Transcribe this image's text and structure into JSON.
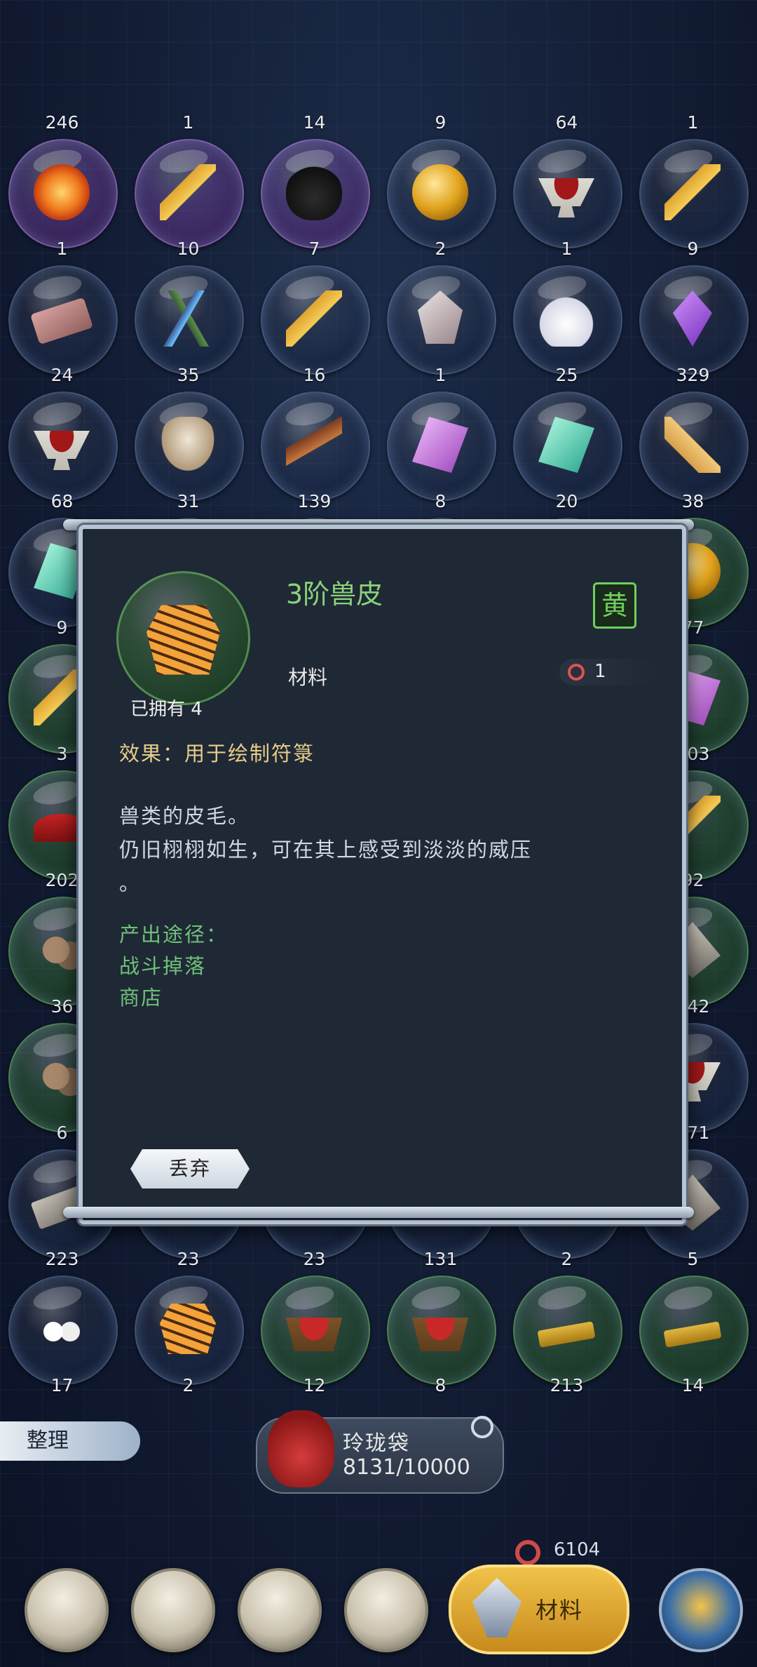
{
  "inventory": {
    "rows": [
      {
        "counts": [
          "246",
          "1",
          "14",
          "9",
          "64",
          "1"
        ],
        "items": [
          [
            "fire-orb",
            "fire",
            "purple"
          ],
          [
            "golden-feather",
            "feather",
            "purple"
          ],
          [
            "beetle",
            "beetle",
            "purple"
          ],
          [
            "gold-orb",
            "goldorb",
            ""
          ],
          [
            "blood-bowl",
            "bowl",
            ""
          ],
          [
            "golden-feather",
            "feather",
            ""
          ]
        ]
      },
      {
        "counts": [
          "1",
          "10",
          "7",
          "2",
          "1",
          "9"
        ],
        "items": [
          [
            "pink-brick",
            "brick",
            ""
          ],
          [
            "lightning-branch",
            "branch",
            ""
          ],
          [
            "golden-feather",
            "feather",
            ""
          ],
          [
            "quartz",
            "crystal",
            ""
          ],
          [
            "white-lotus",
            "lotus",
            ""
          ],
          [
            "purple-gem",
            "gem",
            ""
          ]
        ]
      },
      {
        "counts": [
          "24",
          "35",
          "16",
          "1",
          "25",
          "329"
        ],
        "items": [
          [
            "blood-bowl",
            "bowl",
            ""
          ],
          [
            "lingzhi",
            "fungus",
            ""
          ],
          [
            "wood-bundle",
            "wood",
            ""
          ],
          [
            "pink-gem",
            "pinkgem",
            ""
          ],
          [
            "jade",
            "jade",
            ""
          ],
          [
            "ginseng",
            "root",
            ""
          ]
        ]
      },
      {
        "counts": [
          "68",
          "31",
          "139",
          "8",
          "20",
          "38"
        ],
        "items": [
          [
            "blue-leaf",
            "jade",
            ""
          ],
          [
            "x",
            "",
            ""
          ],
          [
            "x",
            "",
            ""
          ],
          [
            "x",
            "",
            ""
          ],
          [
            "x",
            "",
            ""
          ],
          [
            "gold-orb",
            "goldorb",
            "green"
          ]
        ]
      },
      {
        "counts": [
          "9",
          "",
          "",
          "",
          "",
          "77"
        ],
        "items": [
          [
            "golden-feather",
            "feather",
            "green"
          ],
          [
            "x",
            "",
            ""
          ],
          [
            "x",
            "",
            ""
          ],
          [
            "x",
            "",
            ""
          ],
          [
            "x",
            "",
            ""
          ],
          [
            "pink-gem",
            "pinkgem",
            "green"
          ]
        ]
      },
      {
        "counts": [
          "3",
          "",
          "",
          "",
          "",
          "203"
        ],
        "items": [
          [
            "red-pile",
            "redpile",
            "green"
          ],
          [
            "x",
            "",
            ""
          ],
          [
            "x",
            "",
            ""
          ],
          [
            "x",
            "",
            ""
          ],
          [
            "x",
            "",
            ""
          ],
          [
            "golden-feather",
            "feather",
            "green"
          ]
        ]
      },
      {
        "counts": [
          "202",
          "",
          "",
          "",
          "",
          "92"
        ],
        "items": [
          [
            "pebbles",
            "pebbles",
            "green"
          ],
          [
            "x",
            "",
            ""
          ],
          [
            "x",
            "",
            ""
          ],
          [
            "x",
            "",
            ""
          ],
          [
            "x",
            "",
            ""
          ],
          [
            "shell",
            "shell",
            "green"
          ]
        ]
      },
      {
        "counts": [
          "36",
          "",
          "",
          "",
          "",
          "142"
        ],
        "items": [
          [
            "pebbles",
            "pebbles",
            "green"
          ],
          [
            "x",
            "",
            ""
          ],
          [
            "x",
            "",
            ""
          ],
          [
            "x",
            "",
            ""
          ],
          [
            "x",
            "",
            ""
          ],
          [
            "blood-bowl",
            "bowl",
            ""
          ]
        ]
      },
      {
        "counts": [
          "6",
          "",
          "",
          "",
          "",
          "171"
        ],
        "items": [
          [
            "silver-bar",
            "silverbar",
            ""
          ],
          [
            "x",
            "",
            ""
          ],
          [
            "x",
            "",
            ""
          ],
          [
            "x",
            "",
            ""
          ],
          [
            "x",
            "",
            ""
          ],
          [
            "shell",
            "shell",
            ""
          ]
        ]
      },
      {
        "counts": [
          "223",
          "23",
          "23",
          "131",
          "2",
          "5"
        ],
        "items": [
          [
            "eggs",
            "eggs",
            ""
          ],
          [
            "tiger-pelt",
            "tiger",
            ""
          ],
          [
            "red-powder",
            "redpowder",
            "green"
          ],
          [
            "red-powder",
            "redpowder",
            "green"
          ],
          [
            "yellow-scroll",
            "scroll",
            "green"
          ],
          [
            "yellow-scroll",
            "scroll",
            "green"
          ]
        ]
      },
      {
        "counts": [
          "17",
          "2",
          "12",
          "8",
          "213",
          "14"
        ],
        "items": []
      }
    ]
  },
  "modal": {
    "item_name": "3阶兽皮",
    "grade_badge": "黄",
    "category": "材料",
    "price": "1",
    "owned": "已拥有 4",
    "effect": "效果：用于绘制符箓",
    "description_line1": "兽类的皮毛。",
    "description_line2": "仍旧栩栩如生，可在其上感受到淡淡的威压",
    "description_line3": "。",
    "sources_title": "产出途径：",
    "sources": [
      "战斗掉落",
      "商店"
    ],
    "discard_label": "丢弃"
  },
  "bottom": {
    "sort_label": "整理",
    "bag_name": "玲珑袋",
    "bag_capacity": "8131/10000",
    "currency": "6104"
  },
  "nav": {
    "active_label": "材料",
    "icons": [
      "sword-shield-icon",
      "pouch-icon",
      "book-icon",
      "potion-icon",
      "crystal-icon",
      "swirl-icon"
    ]
  }
}
